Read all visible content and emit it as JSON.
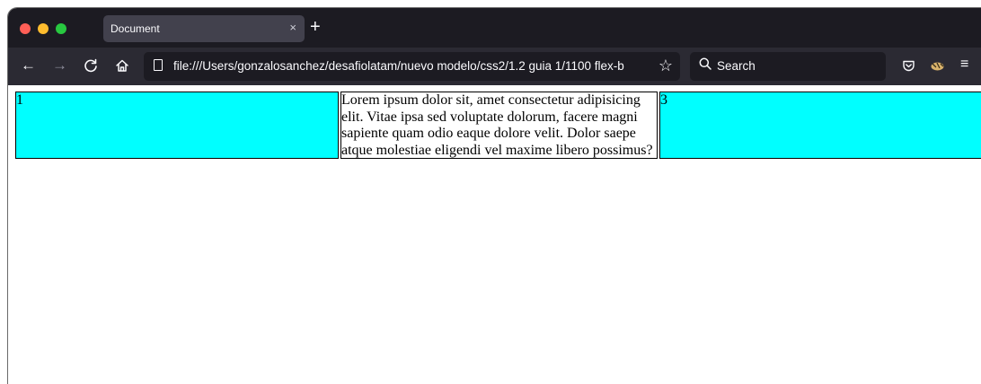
{
  "browser": {
    "tab": {
      "title": "Document",
      "close_glyph": "×"
    },
    "new_tab_glyph": "+",
    "nav": {
      "back_glyph": "←",
      "forward_glyph": "→",
      "reload_glyph": "C",
      "home_glyph": "⌂"
    },
    "url": "file:///Users/gonzalosanchez/desafiolatam/nuevo modelo/css2/1.2 guia 1/1100 flex-b",
    "bookmark_glyph": "☆",
    "search": {
      "placeholder": "Search"
    },
    "toolbar_right": {
      "pocket_glyph": "◡",
      "extension_glyph": "✿",
      "menu_glyph": "≡"
    }
  },
  "page": {
    "boxes": [
      {
        "text": "1"
      },
      {
        "text": "Lorem ipsum dolor sit, amet consectetur adipisicing elit. Vitae ipsa sed voluptate dolorum, facere magni sapiente quam odio eaque dolore velit. Dolor saepe atque molestiae eligendi vel maxime libero possimus?"
      },
      {
        "text": "3"
      }
    ]
  },
  "colors": {
    "tabbar_bg": "#1c1b22",
    "navbar_bg": "#2b2a33",
    "box_fill": "#00ffff",
    "traffic_close": "#ff5f57",
    "traffic_minimize": "#febc2e",
    "traffic_maximize": "#28c840"
  },
  "icons": [
    "close-traffic-light",
    "minimize-traffic-light",
    "maximize-traffic-light",
    "back-arrow-icon",
    "forward-arrow-icon",
    "reload-icon",
    "home-icon",
    "page-icon",
    "bookmark-star-icon",
    "search-icon",
    "pocket-icon",
    "extension-icon",
    "menu-icon"
  ]
}
